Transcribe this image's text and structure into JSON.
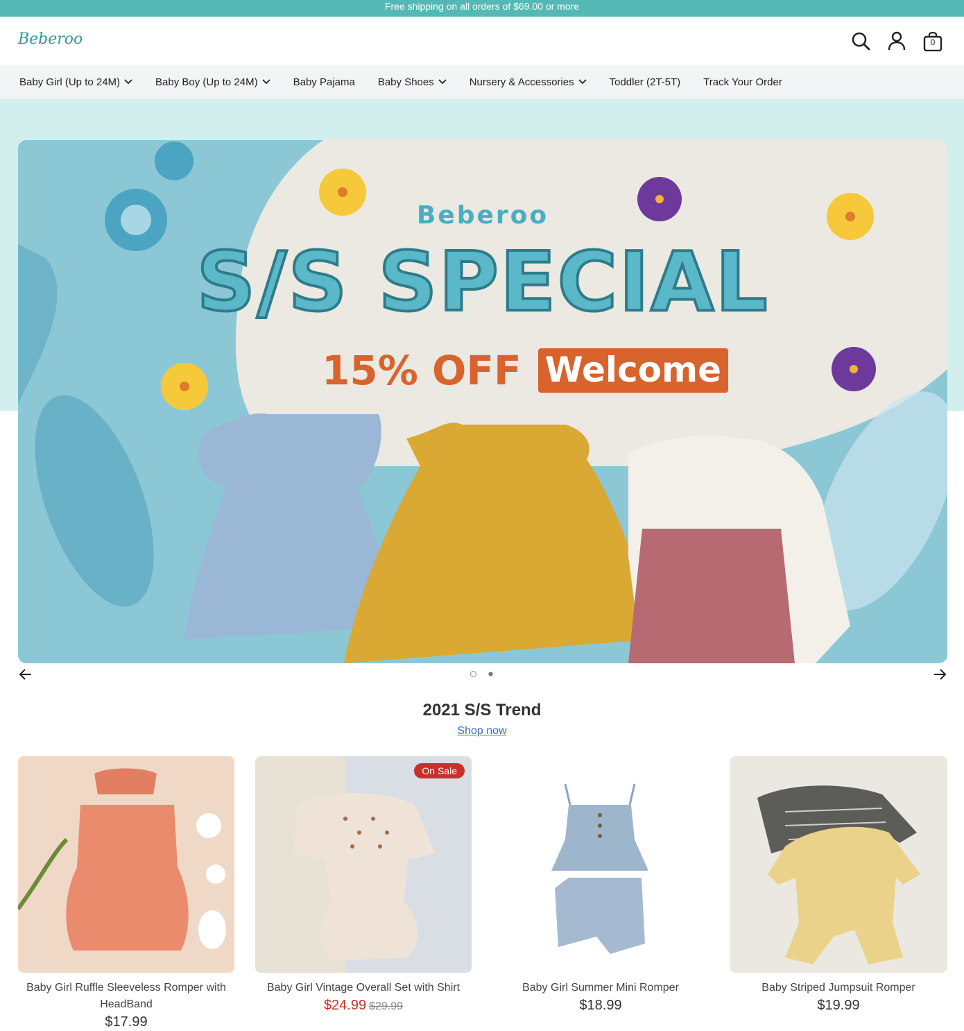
{
  "announcement": "Free shipping on all orders of $69.00 or more",
  "header": {
    "logo": "Beberoo",
    "cart_count": "0",
    "icons": [
      "search-icon",
      "account-icon",
      "cart-icon"
    ]
  },
  "nav": {
    "items": [
      {
        "label": "Baby Girl (Up to 24M)",
        "has_dropdown": true
      },
      {
        "label": "Baby Boy (Up to 24M)",
        "has_dropdown": true
      },
      {
        "label": "Baby Pajama",
        "has_dropdown": false
      },
      {
        "label": "Baby Shoes",
        "has_dropdown": true
      },
      {
        "label": "Nursery & Accessories",
        "has_dropdown": true
      },
      {
        "label": "Toddler (2T-5T)",
        "has_dropdown": false
      },
      {
        "label": "Track Your Order",
        "has_dropdown": false
      }
    ]
  },
  "hero": {
    "brand": "Beberoo",
    "title": "S/S SPECIAL",
    "discount": "15% OFF",
    "code": "Welcome",
    "slide_count": 2,
    "active_slide": 1
  },
  "section": {
    "title": "2021 S/S Trend",
    "link": "Shop now"
  },
  "products": [
    {
      "name": "Baby Girl Ruffle Sleeveless Romper with HeadBand",
      "price": "$17.99",
      "on_sale": false
    },
    {
      "name": "Baby Girl Vintage Overall Set with Shirt",
      "price": "$24.99",
      "compare_price": "$29.99",
      "on_sale": true,
      "badge": "On Sale"
    },
    {
      "name": "Baby Girl Summer Mini Romper",
      "price": "$18.99",
      "on_sale": false
    },
    {
      "name": "Baby Striped Jumpsuit Romper",
      "price": "$19.99",
      "on_sale": false
    }
  ],
  "colors": {
    "brand_teal": "#54b8b4",
    "sale_red": "#c8302a",
    "hero_orange": "#d8632d"
  }
}
